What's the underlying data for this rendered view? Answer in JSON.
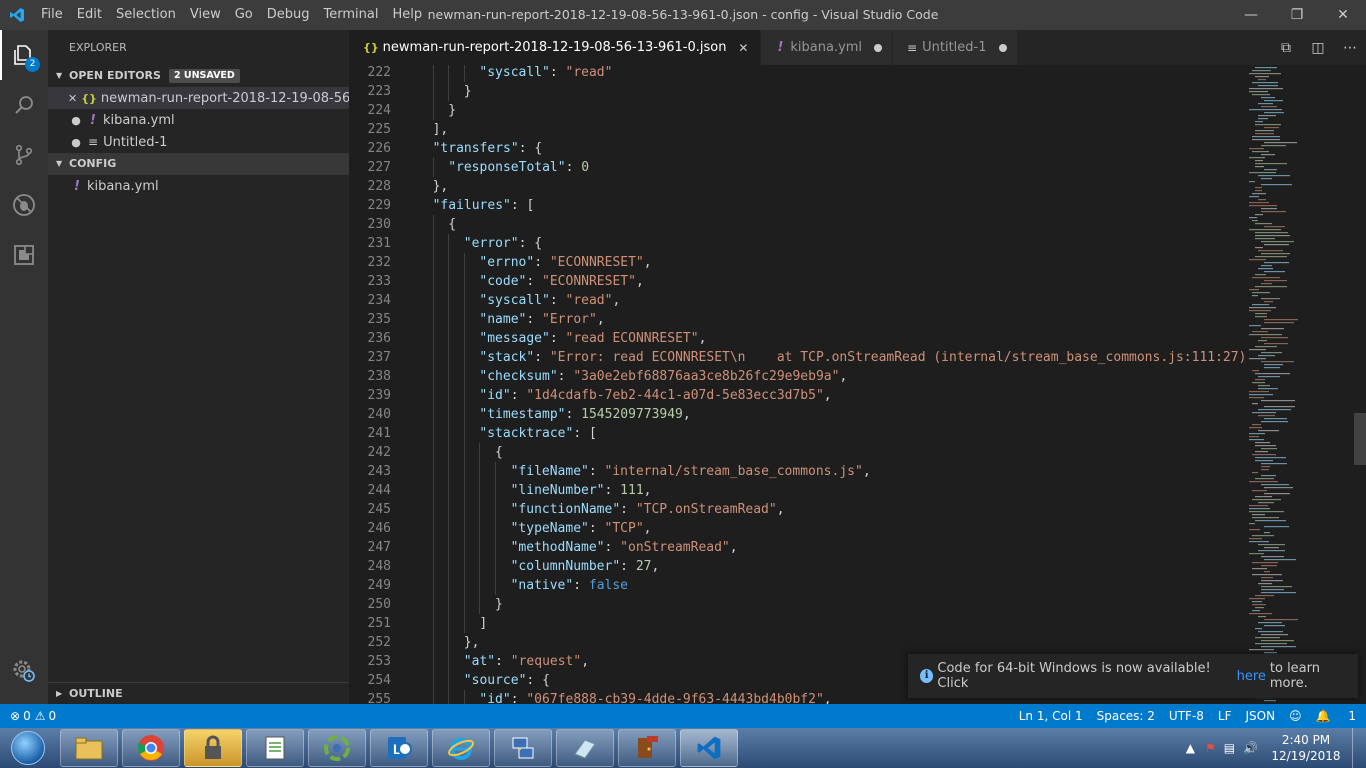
{
  "titlebar": {
    "title": "newman-run-report-2018-12-19-08-56-13-961-0.json - config - Visual Studio Code",
    "menu": [
      "File",
      "Edit",
      "Selection",
      "View",
      "Go",
      "Debug",
      "Terminal",
      "Help"
    ]
  },
  "activitybar": {
    "explorer_badge": "2"
  },
  "sidebar": {
    "title": "EXPLORER",
    "open_editors": {
      "label": "OPEN EDITORS",
      "badge": "2 UNSAVED",
      "items": [
        {
          "name": "newman-run-report-2018-12-19-08-56-...",
          "icon": "{}"
        },
        {
          "name": "kibana.yml",
          "icon": "!"
        },
        {
          "name": "Untitled-1",
          "icon": "≡"
        }
      ]
    },
    "config": {
      "label": "CONFIG",
      "items": [
        {
          "name": "kibana.yml",
          "icon": "!"
        }
      ]
    },
    "outline_label": "OUTLINE"
  },
  "tabs": [
    {
      "label": "newman-run-report-2018-12-19-08-56-13-961-0.json",
      "icon": "{}"
    },
    {
      "label": "kibana.yml",
      "icon": "!"
    },
    {
      "label": "Untitled-1",
      "icon": "≡"
    }
  ],
  "editor": {
    "lines": [
      {
        "n": "222",
        "indent": 4,
        "t": [
          [
            "k",
            "\"syscall\""
          ],
          [
            "p",
            ": "
          ],
          [
            "s",
            "\"read\""
          ]
        ]
      },
      {
        "n": "223",
        "indent": 3,
        "t": [
          [
            "p",
            "}"
          ]
        ]
      },
      {
        "n": "224",
        "indent": 2,
        "t": [
          [
            "p",
            "}"
          ]
        ]
      },
      {
        "n": "225",
        "indent": 1,
        "t": [
          [
            "p",
            "],"
          ]
        ]
      },
      {
        "n": "226",
        "indent": 1,
        "t": [
          [
            "k",
            "\"transfers\""
          ],
          [
            "p",
            ": {"
          ]
        ]
      },
      {
        "n": "227",
        "indent": 2,
        "t": [
          [
            "k",
            "\"responseTotal\""
          ],
          [
            "p",
            ": "
          ],
          [
            "n",
            "0"
          ]
        ]
      },
      {
        "n": "228",
        "indent": 1,
        "t": [
          [
            "p",
            "},"
          ]
        ]
      },
      {
        "n": "229",
        "indent": 1,
        "t": [
          [
            "k",
            "\"failures\""
          ],
          [
            "p",
            ": ["
          ]
        ]
      },
      {
        "n": "230",
        "indent": 2,
        "t": [
          [
            "p",
            "{"
          ]
        ]
      },
      {
        "n": "231",
        "indent": 3,
        "t": [
          [
            "k",
            "\"error\""
          ],
          [
            "p",
            ": {"
          ]
        ]
      },
      {
        "n": "232",
        "indent": 4,
        "t": [
          [
            "k",
            "\"errno\""
          ],
          [
            "p",
            ": "
          ],
          [
            "s",
            "\"ECONNRESET\""
          ],
          [
            "p",
            ","
          ]
        ]
      },
      {
        "n": "233",
        "indent": 4,
        "t": [
          [
            "k",
            "\"code\""
          ],
          [
            "p",
            ": "
          ],
          [
            "s",
            "\"ECONNRESET\""
          ],
          [
            "p",
            ","
          ]
        ]
      },
      {
        "n": "234",
        "indent": 4,
        "t": [
          [
            "k",
            "\"syscall\""
          ],
          [
            "p",
            ": "
          ],
          [
            "s",
            "\"read\""
          ],
          [
            "p",
            ","
          ]
        ]
      },
      {
        "n": "235",
        "indent": 4,
        "t": [
          [
            "k",
            "\"name\""
          ],
          [
            "p",
            ": "
          ],
          [
            "s",
            "\"Error\""
          ],
          [
            "p",
            ","
          ]
        ]
      },
      {
        "n": "236",
        "indent": 4,
        "t": [
          [
            "k",
            "\"message\""
          ],
          [
            "p",
            ": "
          ],
          [
            "s",
            "\"read ECONNRESET\""
          ],
          [
            "p",
            ","
          ]
        ]
      },
      {
        "n": "237",
        "indent": 4,
        "t": [
          [
            "k",
            "\"stack\""
          ],
          [
            "p",
            ": "
          ],
          [
            "s",
            "\"Error: read ECONNRESET\\n    at TCP.onStreamRead (internal/stream_base_commons.js:111:27)"
          ]
        ]
      },
      {
        "n": "238",
        "indent": 4,
        "t": [
          [
            "k",
            "\"checksum\""
          ],
          [
            "p",
            ": "
          ],
          [
            "s",
            "\"3a0e2ebf68876aa3ce8b26fc29e9eb9a\""
          ],
          [
            "p",
            ","
          ]
        ]
      },
      {
        "n": "239",
        "indent": 4,
        "t": [
          [
            "k",
            "\"id\""
          ],
          [
            "p",
            ": "
          ],
          [
            "s",
            "\"1d4cdafb-7eb2-44c1-a07d-5e83ecc3d7b5\""
          ],
          [
            "p",
            ","
          ]
        ]
      },
      {
        "n": "240",
        "indent": 4,
        "t": [
          [
            "k",
            "\"timestamp\""
          ],
          [
            "p",
            ": "
          ],
          [
            "n",
            "1545209773949"
          ],
          [
            "p",
            ","
          ]
        ]
      },
      {
        "n": "241",
        "indent": 4,
        "t": [
          [
            "k",
            "\"stacktrace\""
          ],
          [
            "p",
            ": ["
          ]
        ]
      },
      {
        "n": "242",
        "indent": 5,
        "t": [
          [
            "p",
            "{"
          ]
        ]
      },
      {
        "n": "243",
        "indent": 6,
        "t": [
          [
            "k",
            "\"fileName\""
          ],
          [
            "p",
            ": "
          ],
          [
            "s",
            "\"internal/stream_base_commons.js\""
          ],
          [
            "p",
            ","
          ]
        ]
      },
      {
        "n": "244",
        "indent": 6,
        "t": [
          [
            "k",
            "\"lineNumber\""
          ],
          [
            "p",
            ": "
          ],
          [
            "n",
            "111"
          ],
          [
            "p",
            ","
          ]
        ]
      },
      {
        "n": "245",
        "indent": 6,
        "t": [
          [
            "k",
            "\"functionName\""
          ],
          [
            "p",
            ": "
          ],
          [
            "s",
            "\"TCP.onStreamRead\""
          ],
          [
            "p",
            ","
          ]
        ]
      },
      {
        "n": "246",
        "indent": 6,
        "t": [
          [
            "k",
            "\"typeName\""
          ],
          [
            "p",
            ": "
          ],
          [
            "s",
            "\"TCP\""
          ],
          [
            "p",
            ","
          ]
        ]
      },
      {
        "n": "247",
        "indent": 6,
        "t": [
          [
            "k",
            "\"methodName\""
          ],
          [
            "p",
            ": "
          ],
          [
            "s",
            "\"onStreamRead\""
          ],
          [
            "p",
            ","
          ]
        ]
      },
      {
        "n": "248",
        "indent": 6,
        "t": [
          [
            "k",
            "\"columnNumber\""
          ],
          [
            "p",
            ": "
          ],
          [
            "n",
            "27"
          ],
          [
            "p",
            ","
          ]
        ]
      },
      {
        "n": "249",
        "indent": 6,
        "t": [
          [
            "k",
            "\"native\""
          ],
          [
            "p",
            ": "
          ],
          [
            "b",
            "false"
          ]
        ]
      },
      {
        "n": "250",
        "indent": 5,
        "t": [
          [
            "p",
            "}"
          ]
        ]
      },
      {
        "n": "251",
        "indent": 4,
        "t": [
          [
            "p",
            "]"
          ]
        ]
      },
      {
        "n": "252",
        "indent": 3,
        "t": [
          [
            "p",
            "},"
          ]
        ]
      },
      {
        "n": "253",
        "indent": 3,
        "t": [
          [
            "k",
            "\"at\""
          ],
          [
            "p",
            ": "
          ],
          [
            "s",
            "\"request\""
          ],
          [
            "p",
            ","
          ]
        ]
      },
      {
        "n": "254",
        "indent": 3,
        "t": [
          [
            "k",
            "\"source\""
          ],
          [
            "p",
            ": {"
          ]
        ]
      },
      {
        "n": "255",
        "indent": 4,
        "t": [
          [
            "k",
            "\"id\""
          ],
          [
            "p",
            ": "
          ],
          [
            "s",
            "\"067fe888-cb39-4dde-9f63-4443bd4b0bf2\""
          ],
          [
            "p",
            ","
          ]
        ]
      }
    ]
  },
  "notification": {
    "text_before": "Code for 64-bit Windows is now available! Click",
    "link": "here",
    "text_after": "to learn more."
  },
  "statusbar": {
    "errors": "0",
    "warnings": "0",
    "position": "Ln 1, Col 1",
    "spaces": "Spaces: 2",
    "encoding": "UTF-8",
    "eol": "LF",
    "language": "JSON",
    "notifications": "1"
  },
  "taskbar": {
    "time": "2:40 PM",
    "date": "12/19/2018"
  },
  "colors": {
    "accent": "#007acc",
    "key": "#9cdcfe",
    "string": "#ce9178",
    "number": "#b5cea8",
    "boolean": "#569cd6"
  }
}
